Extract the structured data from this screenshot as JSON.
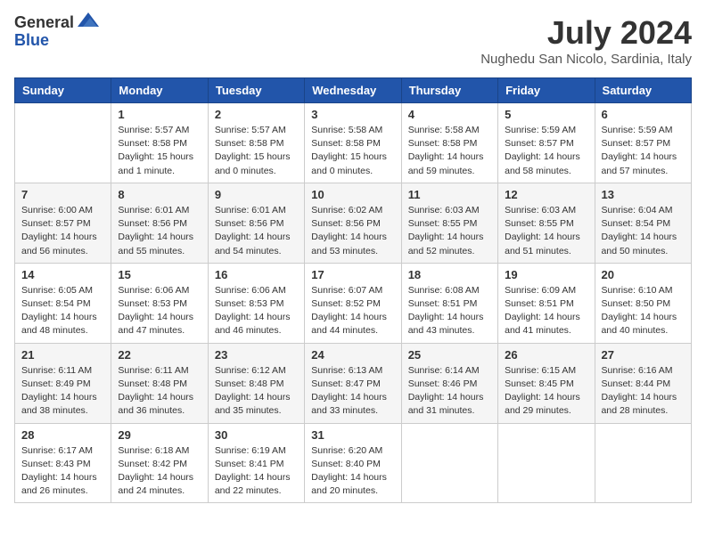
{
  "logo": {
    "general": "General",
    "blue": "Blue"
  },
  "title": {
    "month_year": "July 2024",
    "location": "Nughedu San Nicolo, Sardinia, Italy"
  },
  "header_days": [
    "Sunday",
    "Monday",
    "Tuesday",
    "Wednesday",
    "Thursday",
    "Friday",
    "Saturday"
  ],
  "weeks": [
    [
      {
        "day": "",
        "content": ""
      },
      {
        "day": "1",
        "content": "Sunrise: 5:57 AM\nSunset: 8:58 PM\nDaylight: 15 hours\nand 1 minute."
      },
      {
        "day": "2",
        "content": "Sunrise: 5:57 AM\nSunset: 8:58 PM\nDaylight: 15 hours\nand 0 minutes."
      },
      {
        "day": "3",
        "content": "Sunrise: 5:58 AM\nSunset: 8:58 PM\nDaylight: 15 hours\nand 0 minutes."
      },
      {
        "day": "4",
        "content": "Sunrise: 5:58 AM\nSunset: 8:58 PM\nDaylight: 14 hours\nand 59 minutes."
      },
      {
        "day": "5",
        "content": "Sunrise: 5:59 AM\nSunset: 8:57 PM\nDaylight: 14 hours\nand 58 minutes."
      },
      {
        "day": "6",
        "content": "Sunrise: 5:59 AM\nSunset: 8:57 PM\nDaylight: 14 hours\nand 57 minutes."
      }
    ],
    [
      {
        "day": "7",
        "content": "Sunrise: 6:00 AM\nSunset: 8:57 PM\nDaylight: 14 hours\nand 56 minutes."
      },
      {
        "day": "8",
        "content": "Sunrise: 6:01 AM\nSunset: 8:56 PM\nDaylight: 14 hours\nand 55 minutes."
      },
      {
        "day": "9",
        "content": "Sunrise: 6:01 AM\nSunset: 8:56 PM\nDaylight: 14 hours\nand 54 minutes."
      },
      {
        "day": "10",
        "content": "Sunrise: 6:02 AM\nSunset: 8:56 PM\nDaylight: 14 hours\nand 53 minutes."
      },
      {
        "day": "11",
        "content": "Sunrise: 6:03 AM\nSunset: 8:55 PM\nDaylight: 14 hours\nand 52 minutes."
      },
      {
        "day": "12",
        "content": "Sunrise: 6:03 AM\nSunset: 8:55 PM\nDaylight: 14 hours\nand 51 minutes."
      },
      {
        "day": "13",
        "content": "Sunrise: 6:04 AM\nSunset: 8:54 PM\nDaylight: 14 hours\nand 50 minutes."
      }
    ],
    [
      {
        "day": "14",
        "content": "Sunrise: 6:05 AM\nSunset: 8:54 PM\nDaylight: 14 hours\nand 48 minutes."
      },
      {
        "day": "15",
        "content": "Sunrise: 6:06 AM\nSunset: 8:53 PM\nDaylight: 14 hours\nand 47 minutes."
      },
      {
        "day": "16",
        "content": "Sunrise: 6:06 AM\nSunset: 8:53 PM\nDaylight: 14 hours\nand 46 minutes."
      },
      {
        "day": "17",
        "content": "Sunrise: 6:07 AM\nSunset: 8:52 PM\nDaylight: 14 hours\nand 44 minutes."
      },
      {
        "day": "18",
        "content": "Sunrise: 6:08 AM\nSunset: 8:51 PM\nDaylight: 14 hours\nand 43 minutes."
      },
      {
        "day": "19",
        "content": "Sunrise: 6:09 AM\nSunset: 8:51 PM\nDaylight: 14 hours\nand 41 minutes."
      },
      {
        "day": "20",
        "content": "Sunrise: 6:10 AM\nSunset: 8:50 PM\nDaylight: 14 hours\nand 40 minutes."
      }
    ],
    [
      {
        "day": "21",
        "content": "Sunrise: 6:11 AM\nSunset: 8:49 PM\nDaylight: 14 hours\nand 38 minutes."
      },
      {
        "day": "22",
        "content": "Sunrise: 6:11 AM\nSunset: 8:48 PM\nDaylight: 14 hours\nand 36 minutes."
      },
      {
        "day": "23",
        "content": "Sunrise: 6:12 AM\nSunset: 8:48 PM\nDaylight: 14 hours\nand 35 minutes."
      },
      {
        "day": "24",
        "content": "Sunrise: 6:13 AM\nSunset: 8:47 PM\nDaylight: 14 hours\nand 33 minutes."
      },
      {
        "day": "25",
        "content": "Sunrise: 6:14 AM\nSunset: 8:46 PM\nDaylight: 14 hours\nand 31 minutes."
      },
      {
        "day": "26",
        "content": "Sunrise: 6:15 AM\nSunset: 8:45 PM\nDaylight: 14 hours\nand 29 minutes."
      },
      {
        "day": "27",
        "content": "Sunrise: 6:16 AM\nSunset: 8:44 PM\nDaylight: 14 hours\nand 28 minutes."
      }
    ],
    [
      {
        "day": "28",
        "content": "Sunrise: 6:17 AM\nSunset: 8:43 PM\nDaylight: 14 hours\nand 26 minutes."
      },
      {
        "day": "29",
        "content": "Sunrise: 6:18 AM\nSunset: 8:42 PM\nDaylight: 14 hours\nand 24 minutes."
      },
      {
        "day": "30",
        "content": "Sunrise: 6:19 AM\nSunset: 8:41 PM\nDaylight: 14 hours\nand 22 minutes."
      },
      {
        "day": "31",
        "content": "Sunrise: 6:20 AM\nSunset: 8:40 PM\nDaylight: 14 hours\nand 20 minutes."
      },
      {
        "day": "",
        "content": ""
      },
      {
        "day": "",
        "content": ""
      },
      {
        "day": "",
        "content": ""
      }
    ]
  ]
}
